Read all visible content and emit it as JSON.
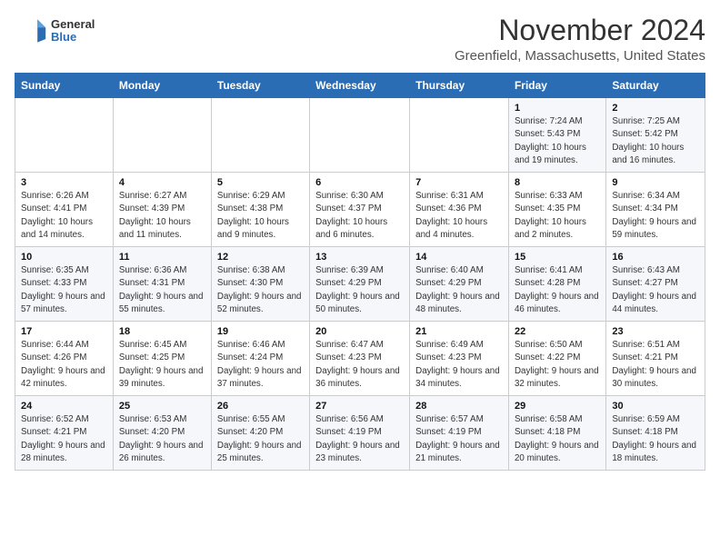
{
  "logo": {
    "line1": "General",
    "line2": "Blue"
  },
  "title": "November 2024",
  "location": "Greenfield, Massachusetts, United States",
  "days_of_week": [
    "Sunday",
    "Monday",
    "Tuesday",
    "Wednesday",
    "Thursday",
    "Friday",
    "Saturday"
  ],
  "weeks": [
    [
      {
        "day": "",
        "info": ""
      },
      {
        "day": "",
        "info": ""
      },
      {
        "day": "",
        "info": ""
      },
      {
        "day": "",
        "info": ""
      },
      {
        "day": "",
        "info": ""
      },
      {
        "day": "1",
        "info": "Sunrise: 7:24 AM\nSunset: 5:43 PM\nDaylight: 10 hours and 19 minutes."
      },
      {
        "day": "2",
        "info": "Sunrise: 7:25 AM\nSunset: 5:42 PM\nDaylight: 10 hours and 16 minutes."
      }
    ],
    [
      {
        "day": "3",
        "info": "Sunrise: 6:26 AM\nSunset: 4:41 PM\nDaylight: 10 hours and 14 minutes."
      },
      {
        "day": "4",
        "info": "Sunrise: 6:27 AM\nSunset: 4:39 PM\nDaylight: 10 hours and 11 minutes."
      },
      {
        "day": "5",
        "info": "Sunrise: 6:29 AM\nSunset: 4:38 PM\nDaylight: 10 hours and 9 minutes."
      },
      {
        "day": "6",
        "info": "Sunrise: 6:30 AM\nSunset: 4:37 PM\nDaylight: 10 hours and 6 minutes."
      },
      {
        "day": "7",
        "info": "Sunrise: 6:31 AM\nSunset: 4:36 PM\nDaylight: 10 hours and 4 minutes."
      },
      {
        "day": "8",
        "info": "Sunrise: 6:33 AM\nSunset: 4:35 PM\nDaylight: 10 hours and 2 minutes."
      },
      {
        "day": "9",
        "info": "Sunrise: 6:34 AM\nSunset: 4:34 PM\nDaylight: 9 hours and 59 minutes."
      }
    ],
    [
      {
        "day": "10",
        "info": "Sunrise: 6:35 AM\nSunset: 4:33 PM\nDaylight: 9 hours and 57 minutes."
      },
      {
        "day": "11",
        "info": "Sunrise: 6:36 AM\nSunset: 4:31 PM\nDaylight: 9 hours and 55 minutes."
      },
      {
        "day": "12",
        "info": "Sunrise: 6:38 AM\nSunset: 4:30 PM\nDaylight: 9 hours and 52 minutes."
      },
      {
        "day": "13",
        "info": "Sunrise: 6:39 AM\nSunset: 4:29 PM\nDaylight: 9 hours and 50 minutes."
      },
      {
        "day": "14",
        "info": "Sunrise: 6:40 AM\nSunset: 4:29 PM\nDaylight: 9 hours and 48 minutes."
      },
      {
        "day": "15",
        "info": "Sunrise: 6:41 AM\nSunset: 4:28 PM\nDaylight: 9 hours and 46 minutes."
      },
      {
        "day": "16",
        "info": "Sunrise: 6:43 AM\nSunset: 4:27 PM\nDaylight: 9 hours and 44 minutes."
      }
    ],
    [
      {
        "day": "17",
        "info": "Sunrise: 6:44 AM\nSunset: 4:26 PM\nDaylight: 9 hours and 42 minutes."
      },
      {
        "day": "18",
        "info": "Sunrise: 6:45 AM\nSunset: 4:25 PM\nDaylight: 9 hours and 39 minutes."
      },
      {
        "day": "19",
        "info": "Sunrise: 6:46 AM\nSunset: 4:24 PM\nDaylight: 9 hours and 37 minutes."
      },
      {
        "day": "20",
        "info": "Sunrise: 6:47 AM\nSunset: 4:23 PM\nDaylight: 9 hours and 36 minutes."
      },
      {
        "day": "21",
        "info": "Sunrise: 6:49 AM\nSunset: 4:23 PM\nDaylight: 9 hours and 34 minutes."
      },
      {
        "day": "22",
        "info": "Sunrise: 6:50 AM\nSunset: 4:22 PM\nDaylight: 9 hours and 32 minutes."
      },
      {
        "day": "23",
        "info": "Sunrise: 6:51 AM\nSunset: 4:21 PM\nDaylight: 9 hours and 30 minutes."
      }
    ],
    [
      {
        "day": "24",
        "info": "Sunrise: 6:52 AM\nSunset: 4:21 PM\nDaylight: 9 hours and 28 minutes."
      },
      {
        "day": "25",
        "info": "Sunrise: 6:53 AM\nSunset: 4:20 PM\nDaylight: 9 hours and 26 minutes."
      },
      {
        "day": "26",
        "info": "Sunrise: 6:55 AM\nSunset: 4:20 PM\nDaylight: 9 hours and 25 minutes."
      },
      {
        "day": "27",
        "info": "Sunrise: 6:56 AM\nSunset: 4:19 PM\nDaylight: 9 hours and 23 minutes."
      },
      {
        "day": "28",
        "info": "Sunrise: 6:57 AM\nSunset: 4:19 PM\nDaylight: 9 hours and 21 minutes."
      },
      {
        "day": "29",
        "info": "Sunrise: 6:58 AM\nSunset: 4:18 PM\nDaylight: 9 hours and 20 minutes."
      },
      {
        "day": "30",
        "info": "Sunrise: 6:59 AM\nSunset: 4:18 PM\nDaylight: 9 hours and 18 minutes."
      }
    ]
  ]
}
